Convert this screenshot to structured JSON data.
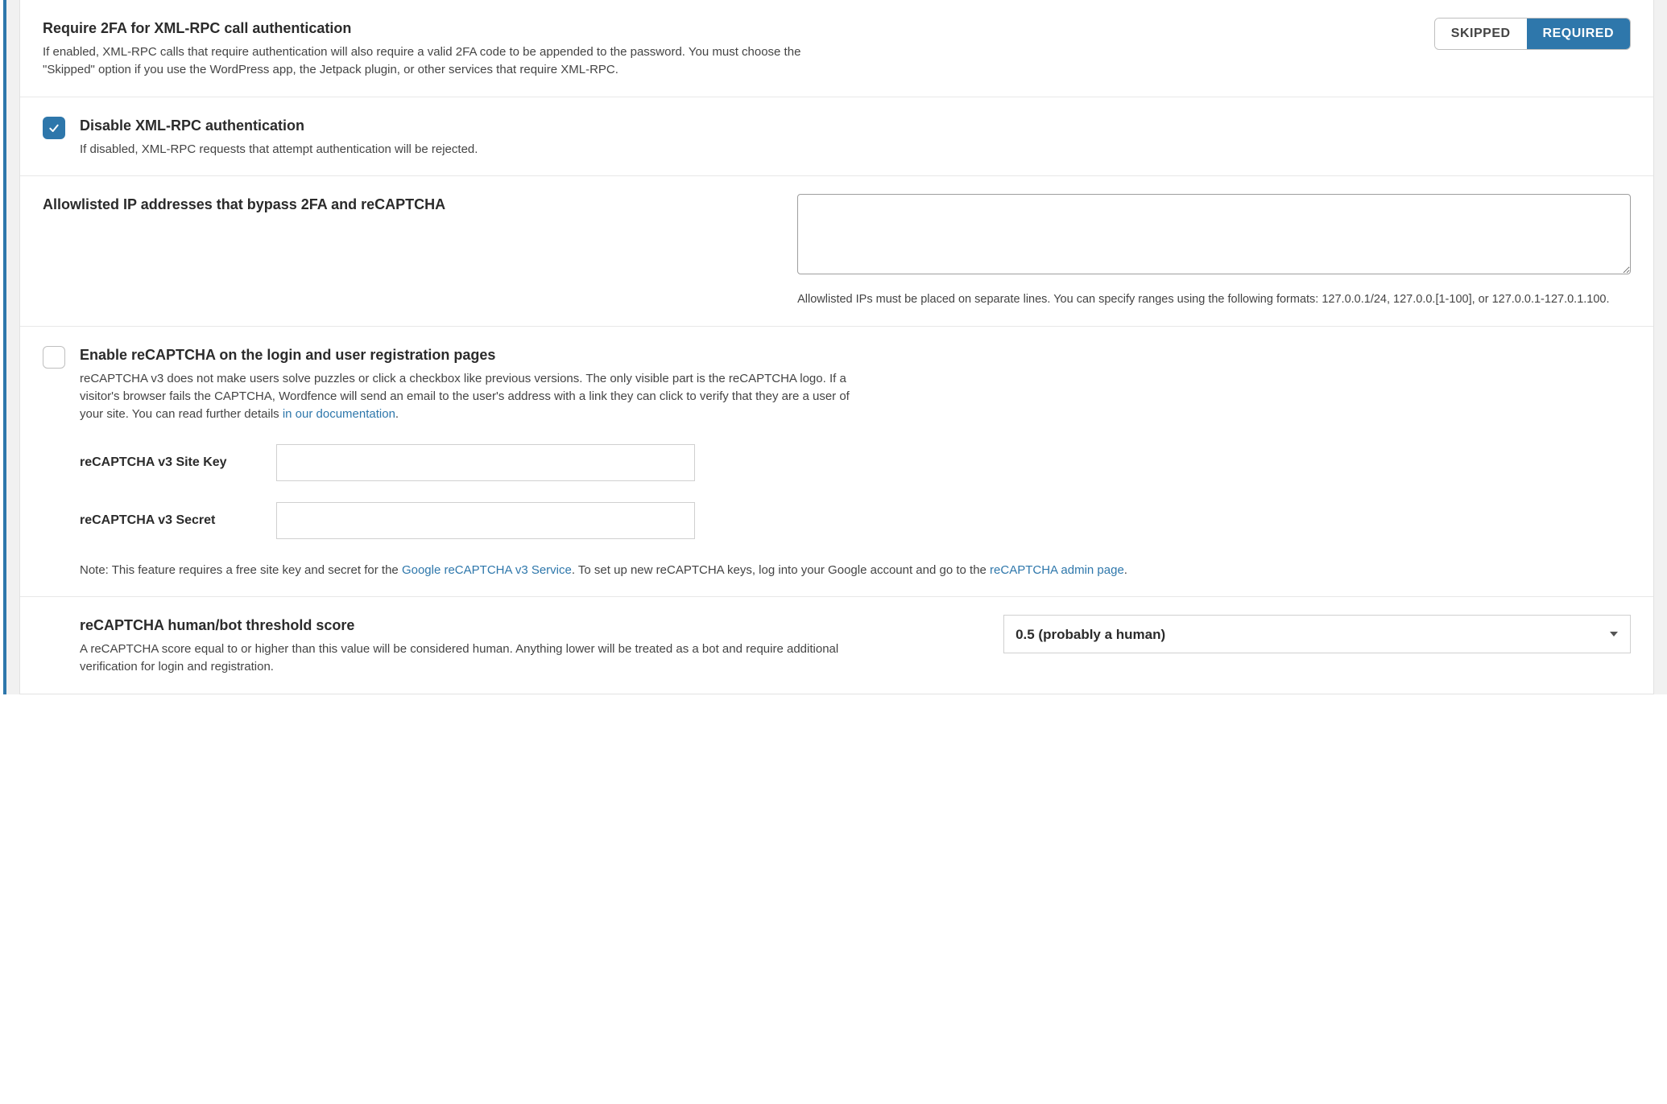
{
  "sections": {
    "xmlrpc2fa": {
      "title": "Require 2FA for XML-RPC call authentication",
      "desc": "If enabled, XML-RPC calls that require authentication will also require a valid 2FA code to be appended to the password. You must choose the \"Skipped\" option if you use the WordPress app, the Jetpack plugin, or other services that require XML-RPC.",
      "skipped_label": "SKIPPED",
      "required_label": "REQUIRED",
      "active": "required"
    },
    "disable_xmlrpc": {
      "title": "Disable XML-RPC authentication",
      "desc": "If disabled, XML-RPC requests that attempt authentication will be rejected.",
      "checked": true
    },
    "allowlist": {
      "title": "Allowlisted IP addresses that bypass 2FA and reCAPTCHA",
      "value": "",
      "hint": "Allowlisted IPs must be placed on separate lines. You can specify ranges using the following formats: 127.0.0.1/24, 127.0.0.[1-100], or 127.0.0.1-127.0.1.100."
    },
    "recaptcha_enable": {
      "title": "Enable reCAPTCHA on the login and user registration pages",
      "desc1": "reCAPTCHA v3 does not make users solve puzzles or click a checkbox like previous versions. The only visible part is the reCAPTCHA logo. If a visitor's browser fails the CAPTCHA, Wordfence will send an email to the user's address with a link they can click to verify that they are a user of your site. You can read further details ",
      "doc_link": "in our documentation",
      "desc1_end": ".",
      "checked": false,
      "site_key_label": "reCAPTCHA v3 Site Key",
      "site_key_value": "",
      "secret_label": "reCAPTCHA v3 Secret",
      "secret_value": "",
      "note_prefix": "Note: This feature requires a free site key and secret for the ",
      "note_link1": "Google reCAPTCHA v3 Service",
      "note_mid": ". To set up new reCAPTCHA keys, log into your Google account and go to the ",
      "note_link2": "reCAPTCHA admin page",
      "note_end": "."
    },
    "threshold": {
      "title": "reCAPTCHA human/bot threshold score",
      "desc": "A reCAPTCHA score equal to or higher than this value will be considered human. Anything lower will be treated as a bot and require additional verification for login and registration.",
      "selected": "0.5 (probably a human)"
    }
  }
}
